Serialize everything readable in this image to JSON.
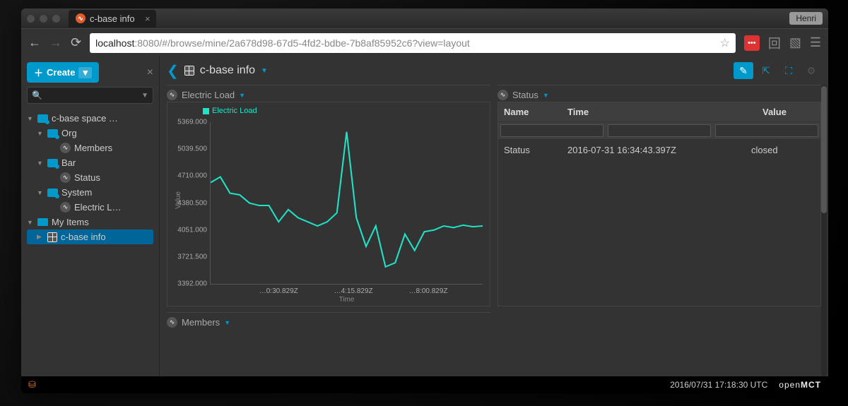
{
  "browser": {
    "tab_title": "c-base info",
    "user": "Henri",
    "url_host": "localhost",
    "url_port": ":8080",
    "url_path": "/#/browse/mine/2a678d98-67d5-4fd2-bdbe-7b8af85952c6?view=layout"
  },
  "sidebar": {
    "create_label": "Create",
    "tree": [
      {
        "label": "c-base space …",
        "icon": "box"
      },
      {
        "label": "Org",
        "icon": "box",
        "indent": 1
      },
      {
        "label": "Members",
        "icon": "telem",
        "indent": 2
      },
      {
        "label": "Bar",
        "icon": "box",
        "indent": 1
      },
      {
        "label": "Status",
        "icon": "telem",
        "indent": 2
      },
      {
        "label": "System",
        "icon": "box",
        "indent": 1
      },
      {
        "label": "Electric L…",
        "icon": "telem",
        "indent": 2
      },
      {
        "label": "My Items",
        "icon": "folder"
      },
      {
        "label": "c-base info",
        "icon": "layout",
        "indent": 1,
        "selected": true
      }
    ]
  },
  "header": {
    "title": "c-base info"
  },
  "panels": {
    "chart_title": "Electric Load",
    "status_title": "Status",
    "members_title": "Members"
  },
  "status_table": {
    "cols": [
      "Name",
      "Time",
      "Value"
    ],
    "row": {
      "name": "Status",
      "time": "2016-07-31 16:34:43.397Z",
      "value": "closed"
    }
  },
  "chart_data": {
    "type": "line",
    "title": "Electric Load",
    "legend": "Electric Load",
    "ylabel": "Value",
    "xlabel": "Time",
    "ylim": [
      3392.0,
      5369.0
    ],
    "yticks": [
      "5369.000",
      "5039.500",
      "4710.000",
      "4380.500",
      "4051.000",
      "3721.500",
      "3392.000"
    ],
    "xticks": [
      "…0:30.829Z",
      "…4:15.829Z",
      "…8:00.829Z"
    ],
    "series": [
      {
        "name": "Electric Load",
        "color": "#1ee3c6",
        "values": [
          4630,
          4700,
          4500,
          4480,
          4380,
          4350,
          4350,
          4150,
          4300,
          4200,
          4150,
          4100,
          4150,
          4260,
          5250,
          4200,
          3850,
          4100,
          3600,
          3650,
          4000,
          3800,
          4030,
          4050,
          4100,
          4080,
          4110,
          4090,
          4100
        ]
      }
    ]
  },
  "statusbar": {
    "time": "2016/07/31 17:18:30 UTC",
    "brand1": "open",
    "brand2": "MCT"
  }
}
